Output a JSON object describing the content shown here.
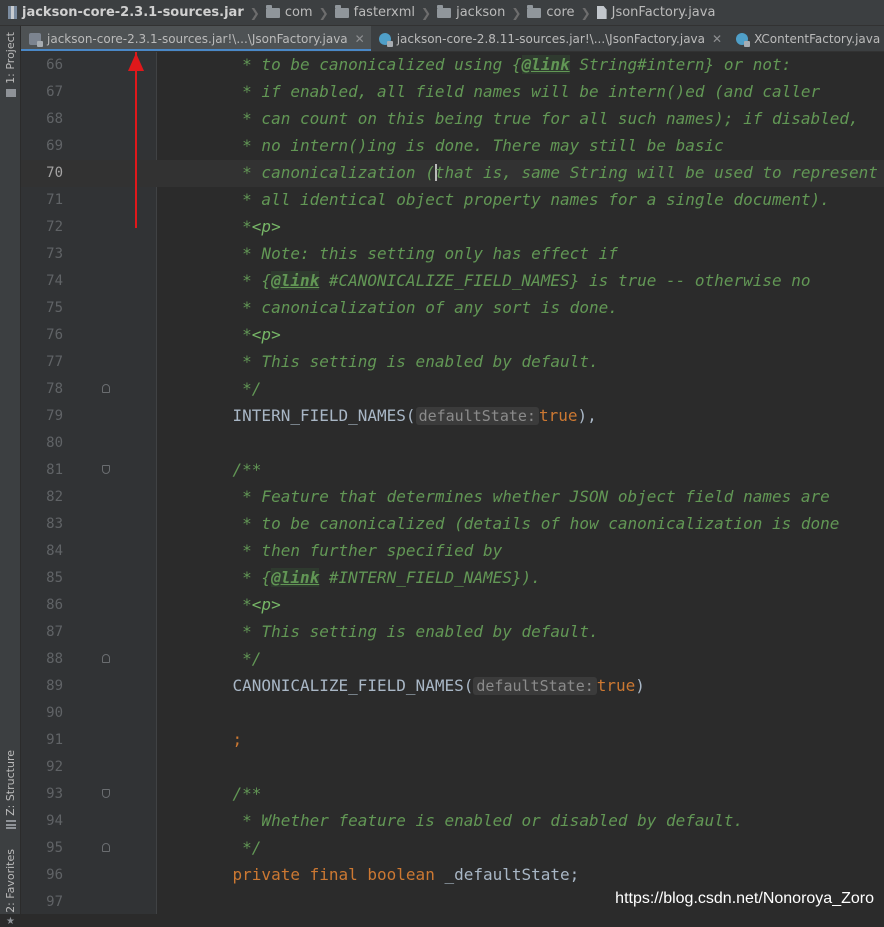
{
  "breadcrumb": {
    "items": [
      {
        "label": "jackson-core-2.3.1-sources.jar",
        "icon": "jar-icon"
      },
      {
        "label": "com",
        "icon": "folder-icon"
      },
      {
        "label": "fasterxml",
        "icon": "folder-icon"
      },
      {
        "label": "jackson",
        "icon": "folder-icon"
      },
      {
        "label": "core",
        "icon": "folder-icon"
      },
      {
        "label": "JsonFactory.java",
        "icon": "file-icon"
      }
    ]
  },
  "sidebar": {
    "project": "1: Project",
    "structure": "Z: Structure",
    "favorites": "2: Favorites"
  },
  "tabs": [
    {
      "label": "jackson-core-2.3.1-sources.jar!\\...\\JsonFactory.java",
      "close": "✕",
      "active": true
    },
    {
      "label": "jackson-core-2.8.11-sources.jar!\\...\\JsonFactory.java",
      "close": "✕",
      "active": false
    },
    {
      "label": "XContentFactory.java",
      "close": "✕",
      "active": false
    }
  ],
  "editor": {
    "current_line": "70",
    "lines": [
      {
        "n": "66",
        "segs": [
          [
            "doc",
            "     * to be canonicalized using {"
          ],
          [
            "doctag",
            "@link"
          ],
          [
            "doc",
            " String#intern} or not:"
          ]
        ]
      },
      {
        "n": "67",
        "segs": [
          [
            "doc",
            "     * if enabled, all field names will be intern()ed (and caller"
          ]
        ]
      },
      {
        "n": "68",
        "segs": [
          [
            "doc",
            "     * can count on this being true for all such names); if disabled,"
          ]
        ]
      },
      {
        "n": "69",
        "segs": [
          [
            "doc",
            "     * no intern()ing is done. There may still be basic"
          ]
        ]
      },
      {
        "n": "70",
        "segs": [
          [
            "doc",
            "     * canonicalization ("
          ],
          [
            "caret",
            ""
          ],
          [
            "doc",
            "that is, same String will be used to represent"
          ]
        ]
      },
      {
        "n": "71",
        "segs": [
          [
            "doc",
            "     * all identical object property names for a single document)."
          ]
        ]
      },
      {
        "n": "72",
        "segs": [
          [
            "doc",
            "     *"
          ],
          [
            "ptag",
            "<p>"
          ]
        ]
      },
      {
        "n": "73",
        "segs": [
          [
            "doc",
            "     * Note: this setting only has effect if"
          ]
        ]
      },
      {
        "n": "74",
        "segs": [
          [
            "doc",
            "     * {"
          ],
          [
            "doctag",
            "@link"
          ],
          [
            "doc",
            " #CANONICALIZE_FIELD_NAMES} is true -- otherwise no"
          ]
        ]
      },
      {
        "n": "75",
        "segs": [
          [
            "doc",
            "     * canonicalization of any sort is done."
          ]
        ]
      },
      {
        "n": "76",
        "segs": [
          [
            "doc",
            "     *"
          ],
          [
            "ptag",
            "<p>"
          ]
        ]
      },
      {
        "n": "77",
        "segs": [
          [
            "doc",
            "     * This setting is enabled by default."
          ]
        ]
      },
      {
        "n": "78",
        "fold": "end",
        "segs": [
          [
            "doc",
            "     */"
          ]
        ]
      },
      {
        "n": "79",
        "segs": [
          [
            "plain",
            "    INTERN_FIELD_NAMES("
          ],
          [
            "hint",
            "defaultState:"
          ],
          [
            "kw",
            "true"
          ],
          [
            "plain",
            "),"
          ]
        ]
      },
      {
        "n": "80",
        "segs": []
      },
      {
        "n": "81",
        "fold": "start",
        "segs": [
          [
            "doc",
            "    /**"
          ]
        ]
      },
      {
        "n": "82",
        "segs": [
          [
            "doc",
            "     * Feature that determines whether JSON object field names are"
          ]
        ]
      },
      {
        "n": "83",
        "segs": [
          [
            "doc",
            "     * to be canonicalized (details of how canonicalization is done"
          ]
        ]
      },
      {
        "n": "84",
        "segs": [
          [
            "doc",
            "     * then further specified by"
          ]
        ]
      },
      {
        "n": "85",
        "segs": [
          [
            "doc",
            "     * {"
          ],
          [
            "doctag",
            "@link"
          ],
          [
            "doc",
            " #INTERN_FIELD_NAMES})."
          ]
        ]
      },
      {
        "n": "86",
        "segs": [
          [
            "doc",
            "     *"
          ],
          [
            "ptag",
            "<p>"
          ]
        ]
      },
      {
        "n": "87",
        "segs": [
          [
            "doc",
            "     * This setting is enabled by default."
          ]
        ]
      },
      {
        "n": "88",
        "fold": "end",
        "segs": [
          [
            "doc",
            "     */"
          ]
        ]
      },
      {
        "n": "89",
        "segs": [
          [
            "plain",
            "    CANONICALIZE_FIELD_NAMES("
          ],
          [
            "hint",
            "defaultState:"
          ],
          [
            "kw",
            "true"
          ],
          [
            "plain",
            ")"
          ]
        ]
      },
      {
        "n": "90",
        "segs": []
      },
      {
        "n": "91",
        "segs": [
          [
            "kw",
            "    ;"
          ]
        ]
      },
      {
        "n": "92",
        "segs": []
      },
      {
        "n": "93",
        "fold": "start",
        "segs": [
          [
            "doc",
            "    /**"
          ]
        ]
      },
      {
        "n": "94",
        "segs": [
          [
            "doc",
            "     * Whether feature is enabled or disabled by default."
          ]
        ]
      },
      {
        "n": "95",
        "fold": "end",
        "segs": [
          [
            "doc",
            "     */"
          ]
        ]
      },
      {
        "n": "96",
        "segs": [
          [
            "kw",
            "    private final boolean "
          ],
          [
            "plain",
            "_defaultState;"
          ]
        ]
      },
      {
        "n": "97",
        "segs": []
      }
    ]
  },
  "watermark": "https://blog.csdn.net/Nonoroya_Zoro",
  "colors": {
    "accent_tab": "#4a88c7",
    "arrow": "#e0181b",
    "doc_comment": "#629755",
    "keyword": "#cc7832"
  }
}
